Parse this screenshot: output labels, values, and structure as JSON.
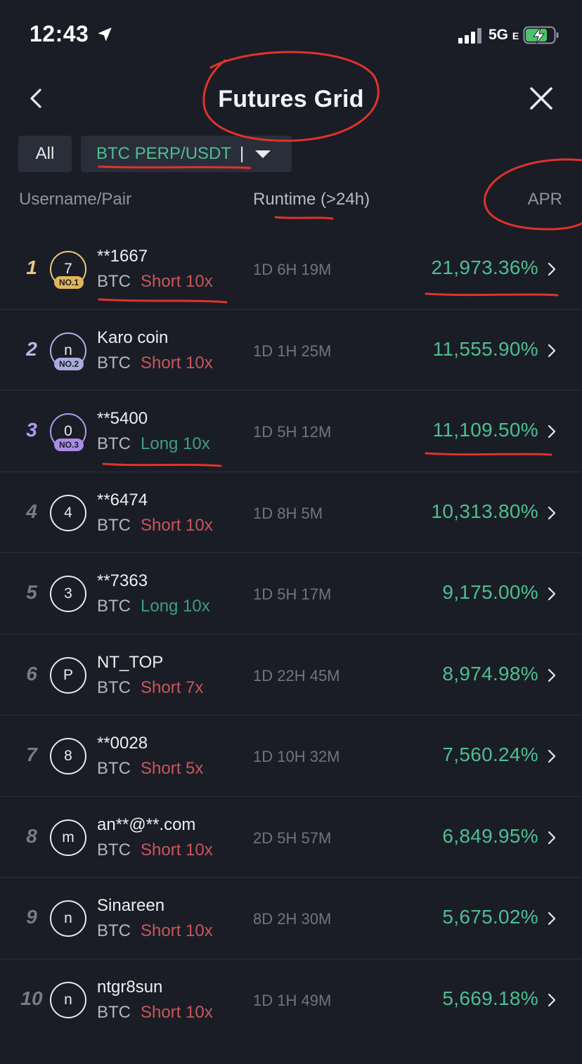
{
  "status_bar": {
    "time": "12:43",
    "network": "5G",
    "network_suffix": "E",
    "icons": [
      "location-arrow-icon",
      "signal-bars-icon",
      "battery-charging-icon"
    ]
  },
  "header": {
    "title": "Futures Grid",
    "back_icon": "chevron-left-icon",
    "close_icon": "close-icon"
  },
  "filters": {
    "all_label": "All",
    "pair_label": "BTC PERP/USDT",
    "pair_separator": "|",
    "pair_icon": "caret-down-icon"
  },
  "columns": {
    "user": "Username/Pair",
    "runtime": "Runtime (>24h)",
    "apr": "APR"
  },
  "colors": {
    "background": "#1a1d26",
    "positive": "#4cbf91",
    "short": "#c8575a",
    "long": "#3f9f7c",
    "annotation": "#e0332a"
  },
  "rows": [
    {
      "rank": "1",
      "avatar": "7",
      "badge": "NO.1",
      "username": "**1667",
      "coin": "BTC",
      "direction": "Short 10x",
      "runtime": "1D 6H 19M",
      "apr": "21,973.36%"
    },
    {
      "rank": "2",
      "avatar": "n",
      "badge": "NO.2",
      "username": "Karo coin",
      "coin": "BTC",
      "direction": "Short 10x",
      "runtime": "1D 1H 25M",
      "apr": "11,555.90%"
    },
    {
      "rank": "3",
      "avatar": "0",
      "badge": "NO.3",
      "username": "**5400",
      "coin": "BTC",
      "direction": "Long 10x",
      "runtime": "1D 5H 12M",
      "apr": "11,109.50%"
    },
    {
      "rank": "4",
      "avatar": "4",
      "username": "**6474",
      "coin": "BTC",
      "direction": "Short 10x",
      "runtime": "1D 8H 5M",
      "apr": "10,313.80%"
    },
    {
      "rank": "5",
      "avatar": "3",
      "username": "**7363",
      "coin": "BTC",
      "direction": "Long 10x",
      "runtime": "1D 5H 17M",
      "apr": "9,175.00%"
    },
    {
      "rank": "6",
      "avatar": "P",
      "username": "NT_TOP",
      "coin": "BTC",
      "direction": "Short 7x",
      "runtime": "1D 22H 45M",
      "apr": "8,974.98%"
    },
    {
      "rank": "7",
      "avatar": "8",
      "username": "**0028",
      "coin": "BTC",
      "direction": "Short 5x",
      "runtime": "1D 10H 32M",
      "apr": "7,560.24%"
    },
    {
      "rank": "8",
      "avatar": "m",
      "username": "an**@**.com",
      "coin": "BTC",
      "direction": "Short 10x",
      "runtime": "2D 5H 57M",
      "apr": "6,849.95%"
    },
    {
      "rank": "9",
      "avatar": "n",
      "username": "Sinareen",
      "coin": "BTC",
      "direction": "Short 10x",
      "runtime": "8D 2H 30M",
      "apr": "5,675.02%"
    },
    {
      "rank": "10",
      "avatar": "n",
      "username": "ntgr8sun",
      "coin": "BTC",
      "direction": "Short 10x",
      "runtime": "1D 1H 49M",
      "apr": "5,669.18%"
    }
  ]
}
